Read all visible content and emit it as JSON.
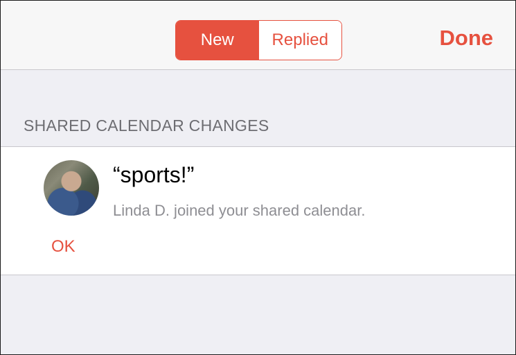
{
  "navbar": {
    "segments": [
      "New",
      "Replied"
    ],
    "selected_segment": "New",
    "done_label": "Done"
  },
  "section": {
    "header": "SHARED CALENDAR CHANGES"
  },
  "notification": {
    "title": "“sports!”",
    "message": "Linda D. joined your shared calendar.",
    "ok_label": "OK"
  },
  "colors": {
    "accent": "#e6513f",
    "background": "#efeff4",
    "secondary_text": "#8e8e93"
  }
}
